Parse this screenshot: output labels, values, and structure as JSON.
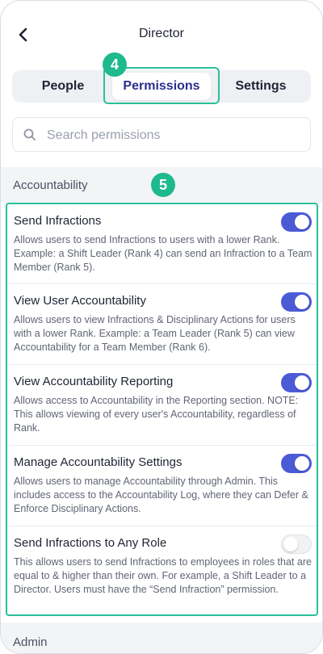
{
  "header": {
    "title": "Director"
  },
  "tabs": [
    {
      "label": "People"
    },
    {
      "label": "Permissions",
      "selected": true
    },
    {
      "label": "Settings"
    }
  ],
  "badges": {
    "tab_step": "4",
    "list_step": "5"
  },
  "search": {
    "placeholder": "Search permissions"
  },
  "sections": [
    {
      "title": "Accountability",
      "items": [
        {
          "name": "Send Infractions",
          "description": "Allows users to send Infractions to users with a lower Rank. Example: a Shift Leader (Rank 4) can send an Infraction to a Team Member (Rank 5).",
          "enabled": true
        },
        {
          "name": "View User Accountability",
          "description": "Allows users to view Infractions & Disciplinary Actions for users with a lower Rank. Example: a Team Leader (Rank 5) can view Accountability for a Team Member (Rank 6).",
          "enabled": true
        },
        {
          "name": "View Accountability Reporting",
          "description": "Allows access to Accountability in the Reporting section. NOTE: This allows viewing of every user's Accountability, regardless of Rank.",
          "enabled": true
        },
        {
          "name": "Manage Accountability Settings",
          "description": "Allows users to manage Accountability through Admin. This includes access to the Accountability Log, where they can Defer & Enforce Disciplinary Actions.",
          "enabled": true
        },
        {
          "name": "Send Infractions to Any Role",
          "description": "This allows users to send Infractions to employees in roles that are equal to & higher than their own.  For example, a Shift Leader to a Director. Users must have the “Send Infraction” permission.",
          "enabled": false
        }
      ]
    },
    {
      "title": "Admin",
      "items": []
    }
  ],
  "colors": {
    "accent": "#4b5bd6",
    "highlight": "#2bbf9a",
    "badge": "#1fb98e"
  }
}
